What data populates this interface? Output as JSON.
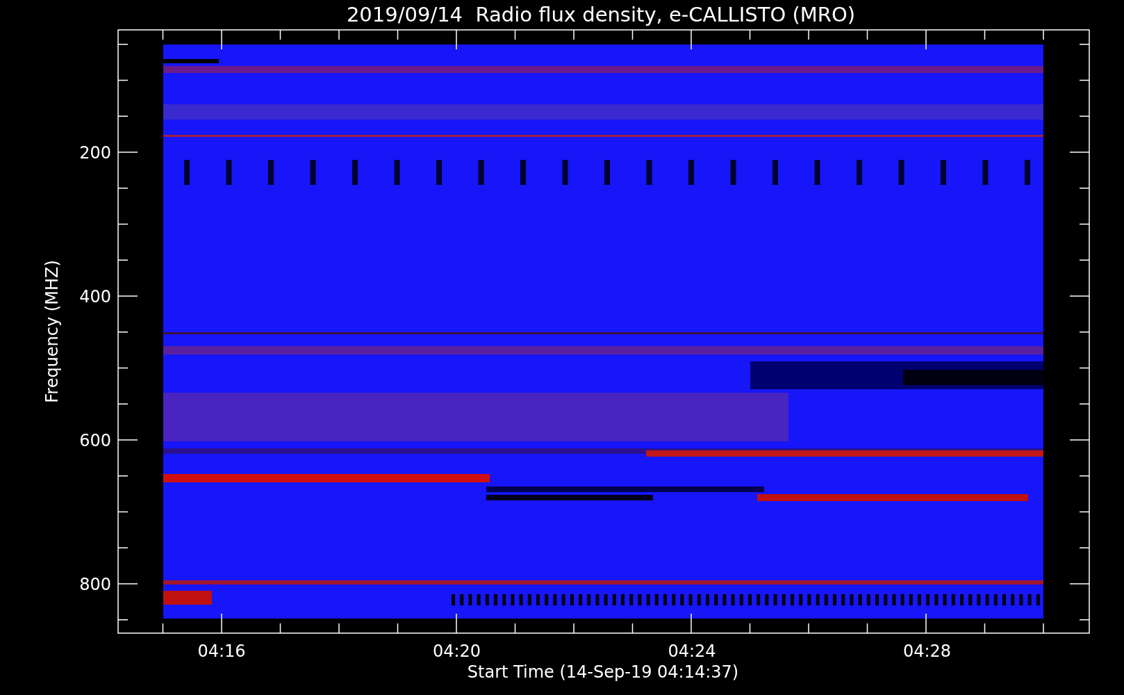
{
  "title": "2019/09/14  Radio flux density, e-CALLISTO (MRO)",
  "y_axis": {
    "label": "Frequency (MHZ)",
    "ticks": [
      "200",
      "400",
      "600",
      "800"
    ]
  },
  "x_axis": {
    "label": "Start Time (14-Sep-19 04:14:37)",
    "ticks": [
      "04:16",
      "04:20",
      "04:24",
      "04:28"
    ]
  }
}
